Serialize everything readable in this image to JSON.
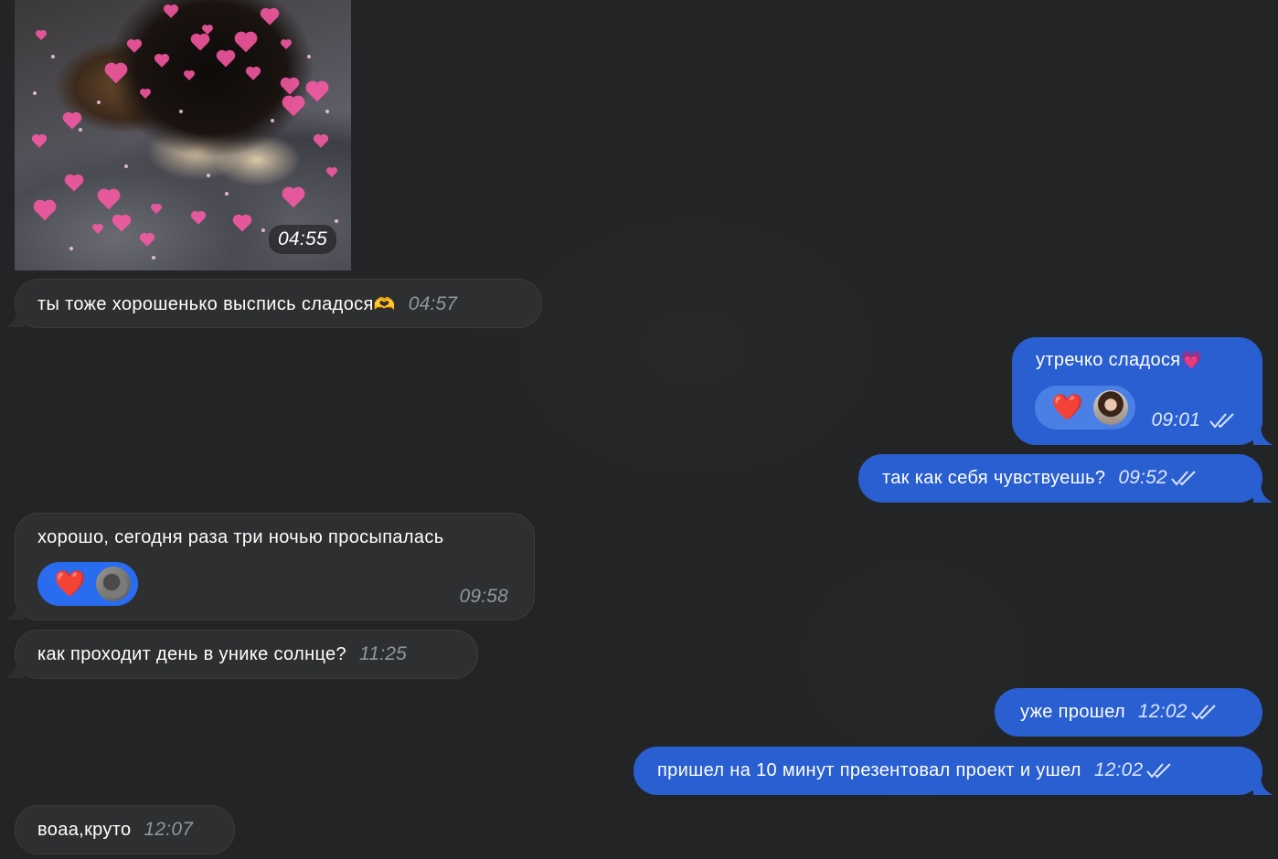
{
  "colors": {
    "background": "#232527",
    "incoming_bubble": "#2e2f31",
    "outgoing_bubble": "#2a5fd1",
    "reaction_incoming": "#2a6cf0",
    "reaction_outgoing": "#4a7fe6",
    "timestamp_in": "#8f969e",
    "timestamp_out": "#dbe6ff"
  },
  "photo_message": {
    "time": "04:55"
  },
  "messages": [
    {
      "direction": "in",
      "text": "ты тоже хорошенько выспись сладося",
      "emoji": "🫶",
      "time": "04:57"
    },
    {
      "direction": "out",
      "text": "утречко сладося",
      "emoji": "💗",
      "time": "09:01",
      "reaction": {
        "icon": "heart-icon",
        "emoji": "❤️"
      },
      "status": "read-double-check-icon"
    },
    {
      "direction": "out",
      "text": "так как себя чувствуешь?",
      "time": "09:52",
      "status": "read-double-check-icon"
    },
    {
      "direction": "in",
      "text": "хорошо, сегодня раза три ночью просыпалась",
      "time": "09:58",
      "reaction": {
        "icon": "heart-icon",
        "emoji": "❤️"
      }
    },
    {
      "direction": "in",
      "text": "как проходит день в унике солнце?",
      "time": "11:25"
    },
    {
      "direction": "out",
      "text": "уже прошел",
      "time": "12:02",
      "status": "read-double-check-icon"
    },
    {
      "direction": "out",
      "text": "пришел на 10 минут презентовал проект и ушел",
      "time": "12:02",
      "status": "read-double-check-icon"
    },
    {
      "direction": "in",
      "text": "воаа,круто",
      "time": "12:07"
    }
  ]
}
